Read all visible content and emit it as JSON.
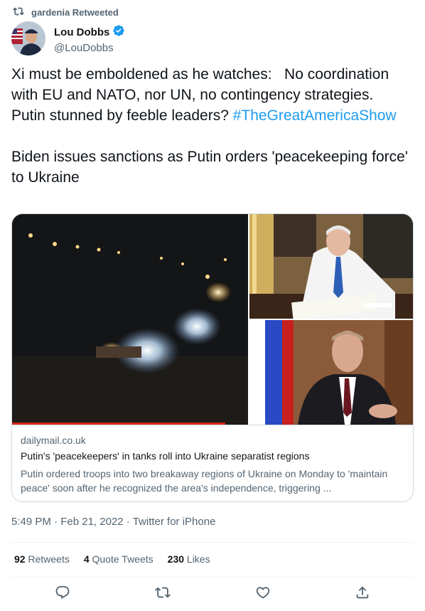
{
  "retweet_bar": {
    "text": "gardenia Retweeted"
  },
  "author": {
    "display_name": "Lou Dobbs",
    "handle": "@LouDobbs"
  },
  "tweet": {
    "text_main": "Xi must be emboldened as he watches:   No coordination with EU and NATO, nor UN, no contingency strategies.  Putin stunned by feeble leaders? ",
    "hashtag": "#TheGreatAmericaShow",
    "text_second": "Biden issues sanctions as Putin orders 'peacekeeping force' to Ukraine"
  },
  "card": {
    "domain": "dailymail.co.uk",
    "title": "Putin's 'peacekeepers' in tanks roll into Ukraine separatist regions",
    "description": "Putin ordered troops into two breakaway regions of Ukraine on Monday to 'maintain peace' soon after he recognized the area's independence, triggering ..."
  },
  "meta": {
    "time": "5:49 PM",
    "sep1": " · ",
    "date": "Feb 21, 2022",
    "sep2": " · ",
    "source": "Twitter for iPhone"
  },
  "stats": {
    "retweets_count": "92",
    "retweets_label": "Retweets",
    "quotes_count": "4",
    "quotes_label": "Quote Tweets",
    "likes_count": "230",
    "likes_label": "Likes"
  },
  "icons": {
    "retweet": "retweet-icon",
    "verified": "verified-badge-icon",
    "reply": "reply-icon",
    "like": "heart-icon",
    "share": "share-icon"
  },
  "colors": {
    "accent": "#1d9bf0",
    "secondary_text": "#536471",
    "primary_text": "#0f1419"
  }
}
